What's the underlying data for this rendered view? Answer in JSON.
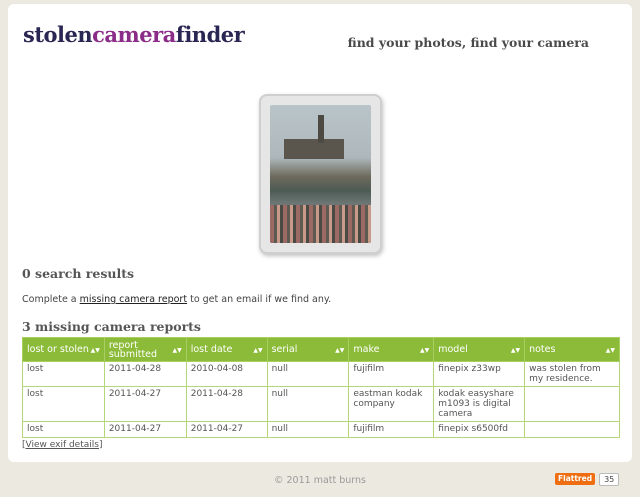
{
  "header": {
    "logo_part1": "stolen",
    "logo_part2": "camera",
    "logo_part3": "finder",
    "tagline": "find your photos, find your camera"
  },
  "search": {
    "results_heading": "0 search results",
    "complete_prefix": "Complete a ",
    "complete_link": "missing camera report",
    "complete_suffix": " to get an email if we find any."
  },
  "reports": {
    "heading": "3 missing camera reports",
    "columns": [
      "lost or stolen",
      "report submitted",
      "lost date",
      "serial",
      "make",
      "model",
      "notes"
    ],
    "rows": [
      [
        "lost",
        "2011-04-28",
        "2010-04-08",
        "null",
        "fujifilm",
        "finepix z33wp",
        "was stolen from my residence."
      ],
      [
        "lost",
        "2011-04-27",
        "2011-04-28",
        "null",
        "eastman kodak company",
        "kodak easyshare m1093 is digital camera",
        ""
      ],
      [
        "lost",
        "2011-04-27",
        "2011-04-27",
        "null",
        "fujifilm",
        "finepix s6500fd",
        ""
      ]
    ]
  },
  "exif": {
    "open": "[",
    "link": "View exif details",
    "close": "]"
  },
  "footer": {
    "copyright": "© 2011 matt burns",
    "flattr_label": "Flattred",
    "flattr_count": "35"
  },
  "colors": {
    "accent_green": "#8cbb3a",
    "logo_dark": "#2a2653",
    "logo_purple": "#8a2c88"
  }
}
